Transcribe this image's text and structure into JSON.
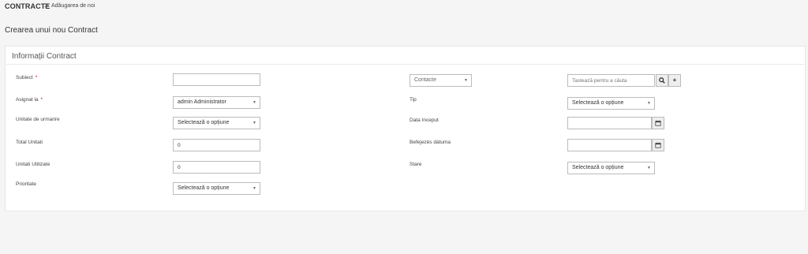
{
  "breadcrumb": {
    "module": "CONTRACTE",
    "separator": ">",
    "page": "Adăugarea de noi"
  },
  "page_title": "Crearea unui nou Contract",
  "panel_title": "Informații Contract",
  "required_mark": "*",
  "left_fields": {
    "subiect": {
      "label": "Subiect",
      "value": ""
    },
    "asignat": {
      "label": "Asignat la",
      "value": "admin Administrator"
    },
    "unitate": {
      "label": "Unitate de urmarire",
      "value": "Selectează o opțiune"
    },
    "total": {
      "label": "Total Unitati",
      "value": "0"
    },
    "utilizate": {
      "label": "Unitati Utilizate",
      "value": "0"
    },
    "prioritate": {
      "label": "Prioritate",
      "value": "Selectează o opțiune"
    }
  },
  "right_fields": {
    "relate_module": "Contacte",
    "relate_placeholder": "Tastează pentru a căuta",
    "tip": {
      "label": "Tip",
      "value": "Selectează o opțiune"
    },
    "data_inceput": {
      "label": "Data Inceput",
      "value": ""
    },
    "befejezes": {
      "label": "Befejezés dátuma",
      "value": ""
    },
    "stare": {
      "label": "Stare",
      "value": "Selectează o opțiune"
    }
  },
  "icons": {
    "search": "search-icon",
    "plus": "plus-icon",
    "calendar": "calendar-icon",
    "caret": "caret-down-icon"
  }
}
